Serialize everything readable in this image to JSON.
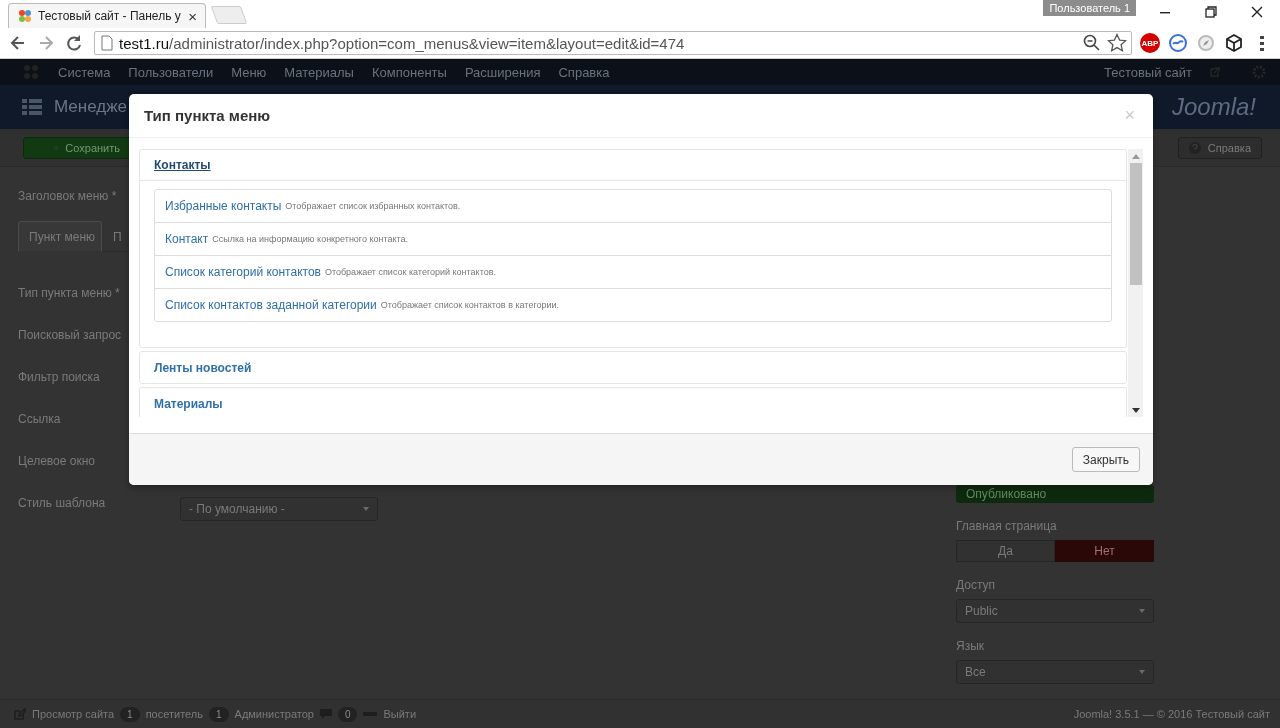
{
  "browser": {
    "tab_title": "Тестовый сайт - Панель у",
    "tab_close": "×",
    "profile": "Пользователь 1",
    "url_host": "test1.ru",
    "url_path": "/administrator/index.php?option=com_menus&view=item&layout=edit&id=474",
    "extension_badge": "ABP"
  },
  "navbar": {
    "items": [
      "Система",
      "Пользователи",
      "Меню",
      "Материалы",
      "Компоненты",
      "Расширения",
      "Справка"
    ],
    "site_link": "Тестовый сайт"
  },
  "header": {
    "title": "Менедже",
    "logo": "Joomla!"
  },
  "toolbar": {
    "buttons": [
      {
        "label": "Сохранить",
        "kind": "save"
      },
      {
        "label": "Справка",
        "kind": "help"
      }
    ]
  },
  "form": {
    "title_label": "Заголовок меню *",
    "tabs": [
      {
        "label": "Пункт меню",
        "selected": true
      },
      {
        "label": "П",
        "selected": false
      }
    ],
    "fields": [
      {
        "label": "Тип пункта меню *"
      },
      {
        "label": "Поисковый запрос"
      },
      {
        "label": "Фильтр поиска"
      },
      {
        "label": "Ссылка"
      },
      {
        "label": "Целевое окно"
      },
      {
        "label": "Стиль шаблона",
        "value": "- По умолчанию -"
      }
    ]
  },
  "sidebar": {
    "status": "Опубликовано",
    "home": {
      "label": "Главная страница",
      "options": [
        {
          "label": "Да",
          "selected": false
        },
        {
          "label": "Нет",
          "selected": true
        }
      ]
    },
    "access": {
      "label": "Доступ",
      "value": "Public"
    },
    "language": {
      "label": "Язык",
      "value": "Все"
    }
  },
  "modal": {
    "title": "Тип пункта меню",
    "close": "×",
    "groups": [
      {
        "title": "Контакты",
        "expanded": true,
        "items": [
          {
            "title": "Избранные контакты",
            "description": "Отображает список избранных контактов."
          },
          {
            "title": "Контакт",
            "description": "Ссылка на информацию конкретного контакта."
          },
          {
            "title": "Список категорий контактов",
            "description": "Отображает список категорий контактов."
          },
          {
            "title": "Список контактов заданной категории",
            "description": "Отображает список контактов в категории."
          }
        ]
      },
      {
        "title": "Ленты новостей",
        "expanded": false
      },
      {
        "title": "Материалы",
        "expanded": false
      }
    ],
    "buttons": [
      "Закрыть"
    ]
  },
  "footer": {
    "items": [
      {
        "kind": "link",
        "label": "Просмотр сайта"
      },
      {
        "kind": "count",
        "count": "1",
        "label": "посетитель"
      },
      {
        "kind": "count",
        "count": "1",
        "label": "Администратор"
      },
      {
        "kind": "mail",
        "count": "0"
      },
      {
        "kind": "logout",
        "label": "Выйти"
      }
    ],
    "copyright": "Joomla! 3.5.1 — © 2016 Тестовый сайт"
  }
}
